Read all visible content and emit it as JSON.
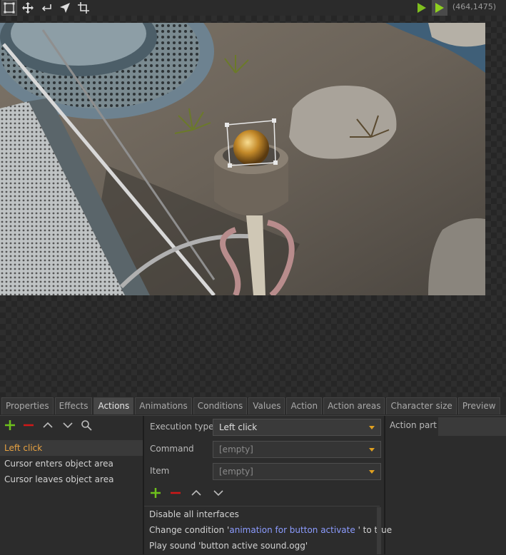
{
  "toolbar": {
    "tools": [
      {
        "icon": "select-rect-icon"
      },
      {
        "icon": "move-icon"
      },
      {
        "icon": "return-icon"
      },
      {
        "icon": "pointer-arrow-icon"
      },
      {
        "icon": "crop-icon"
      }
    ],
    "coords": "(464,1475)"
  },
  "tabs": [
    "Properties",
    "Effects",
    "Actions",
    "Animations",
    "Conditions",
    "Values",
    "Action",
    "Action areas",
    "Character size",
    "Preview"
  ],
  "active_tab": "Actions",
  "events": [
    "Left click",
    "Cursor enters object area",
    "Cursor leaves object area"
  ],
  "selected_event": "Left click",
  "form": {
    "execution_type_label": "Execution type",
    "execution_type_value": "Left click",
    "command_label": "Command",
    "command_value": "[empty]",
    "item_label": "Item",
    "item_value": "[empty]"
  },
  "actions": {
    "line1": "Disable all interfaces",
    "line2_pre": "Change condition '",
    "line2_hl": "animation for button activate",
    "line2_post": " ' to true",
    "line3": "Play sound 'button active sound.ogg'"
  },
  "action_part_label": "Action part",
  "colors": {
    "accent": "#e9a341",
    "add": "#6ec01c",
    "remove": "#d01818",
    "link": "#8c9cff",
    "play": "#7fbf1f"
  }
}
